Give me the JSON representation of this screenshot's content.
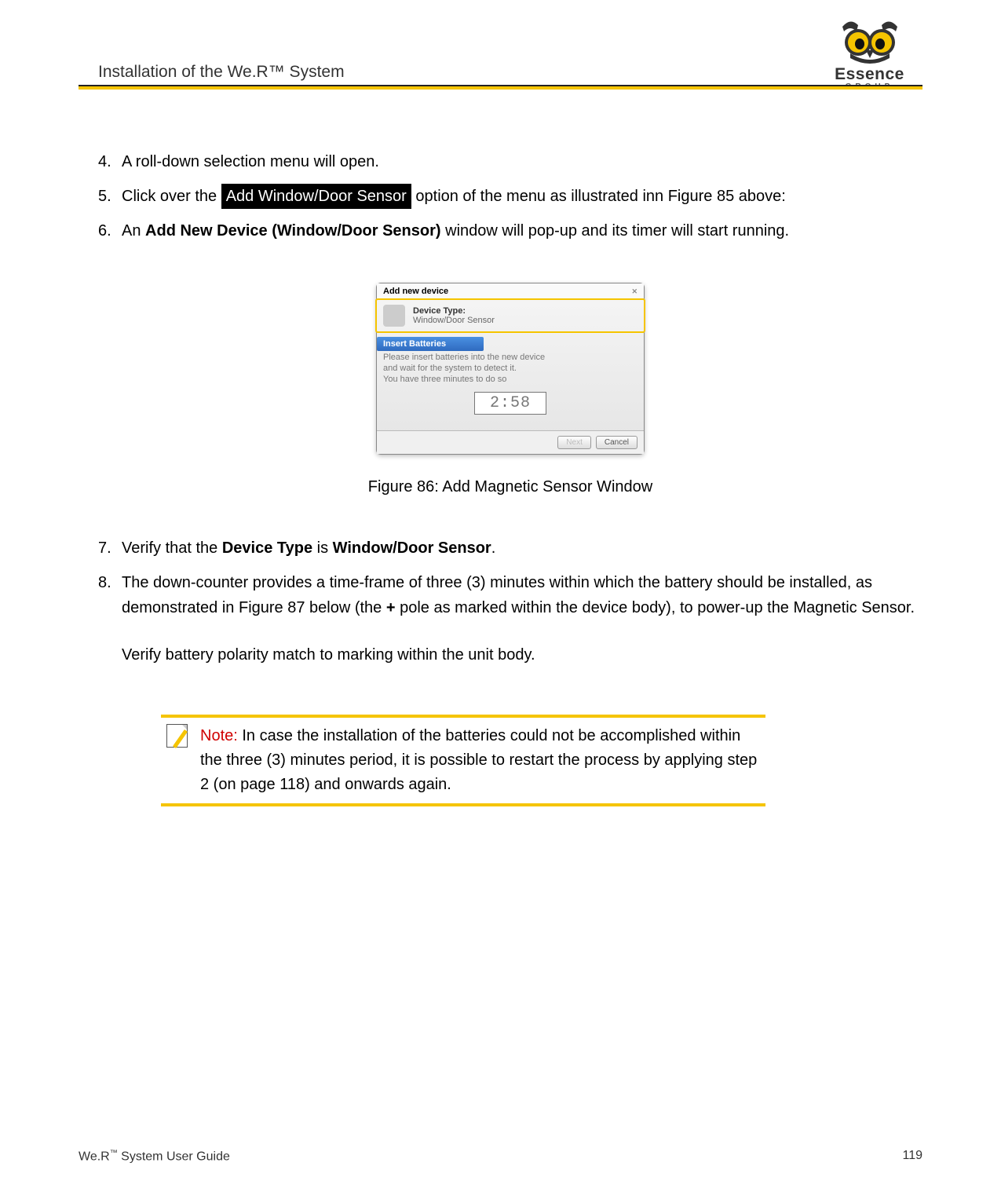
{
  "header": {
    "title": "Installation of the We.R™ System",
    "brand_top": "Essence",
    "brand_bottom": "GROUP"
  },
  "steps": {
    "s4_num": "4.",
    "s4_text": "A roll-down selection menu will open.",
    "s5_num": "5.",
    "s5_a": "Click over the ",
    "s5_chip": " Add Window/Door Sensor ",
    "s5_b": " option of the menu as illustrated inn Figure 85 above:",
    "s6_num": "6.",
    "s6_a": "An ",
    "s6_bold": "Add New Device (Window/Door Sensor)",
    "s6_b": " window will pop-up and its timer will start running.",
    "s7_num": "7.",
    "s7_a": "Verify that the ",
    "s7_bold1": "Device Type",
    "s7_b": " is ",
    "s7_bold2": "Window/Door Sensor",
    "s7_c": ".",
    "s8_num": "8.",
    "s8_a": "The down-counter provides a time-frame of three (3) minutes within which the battery should be installed, as demonstrated in Figure 87 below (the ",
    "s8_plus": "+",
    "s8_b": " pole as marked within the device body), to power-up the Magnetic Sensor.",
    "s8_para2": "Verify battery polarity match to marking within the unit body."
  },
  "dialog": {
    "title": "Add new device",
    "close_glyph": "✕",
    "devtype_label": "Device Type:",
    "devtype_value": "Window/Door Sensor",
    "tab_label": "Insert Batteries",
    "body_line1": "Please insert batteries into the new device",
    "body_line2": "and wait for the system to detect it.",
    "body_line3": "You have three minutes to do so",
    "timer": "2:58",
    "btn_next": "Next",
    "btn_cancel": "Cancel"
  },
  "fig_caption": "Figure 86: Add Magnetic Sensor Window",
  "note": {
    "label": "Note:",
    "text": " In case the installation of the batteries could not be accomplished within the three (3) minutes period, it is possible to restart the process by applying step 2 (on page 118) and onwards again."
  },
  "footer": {
    "left_a": "We.R",
    "left_tm": "™",
    "left_b": " System User Guide",
    "page": "119"
  }
}
